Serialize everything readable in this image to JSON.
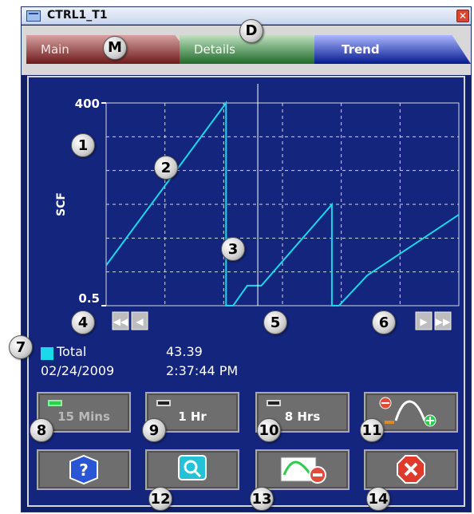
{
  "window": {
    "title": "CTRL1_T1"
  },
  "tabs": [
    {
      "label": "Main",
      "callout": "M"
    },
    {
      "label": "Details",
      "callout": "D"
    },
    {
      "label": "Trend"
    }
  ],
  "chart_data": {
    "type": "line",
    "ylabel": "SCF",
    "y_ticks": [
      "400",
      "0.5"
    ],
    "ylim": [
      0.5,
      400
    ],
    "series": [
      {
        "color": "#19d9ea",
        "points": [
          [
            0.0,
            80
          ],
          [
            0.34,
            400
          ],
          [
            0.34,
            0.5
          ],
          [
            0.36,
            0.5
          ],
          [
            0.4,
            40
          ],
          [
            0.44,
            40
          ],
          [
            0.64,
            200
          ],
          [
            0.64,
            0.5
          ],
          [
            0.66,
            0.5
          ],
          [
            0.74,
            60
          ],
          [
            1.0,
            180
          ]
        ]
      }
    ],
    "cursor_x": 0.43,
    "grid": true
  },
  "legend": {
    "label": "Total",
    "value": "43.39",
    "date": "02/24/2009",
    "time": "2:37:44 PM",
    "color": "#19d9ea"
  },
  "buttons": {
    "b15": "15 Mins",
    "b1": "1 Hr",
    "b8": "8 Hrs"
  },
  "callouts": [
    "1",
    "2",
    "3",
    "4",
    "5",
    "6",
    "7",
    "8",
    "9",
    "10",
    "11",
    "12",
    "13",
    "14"
  ]
}
